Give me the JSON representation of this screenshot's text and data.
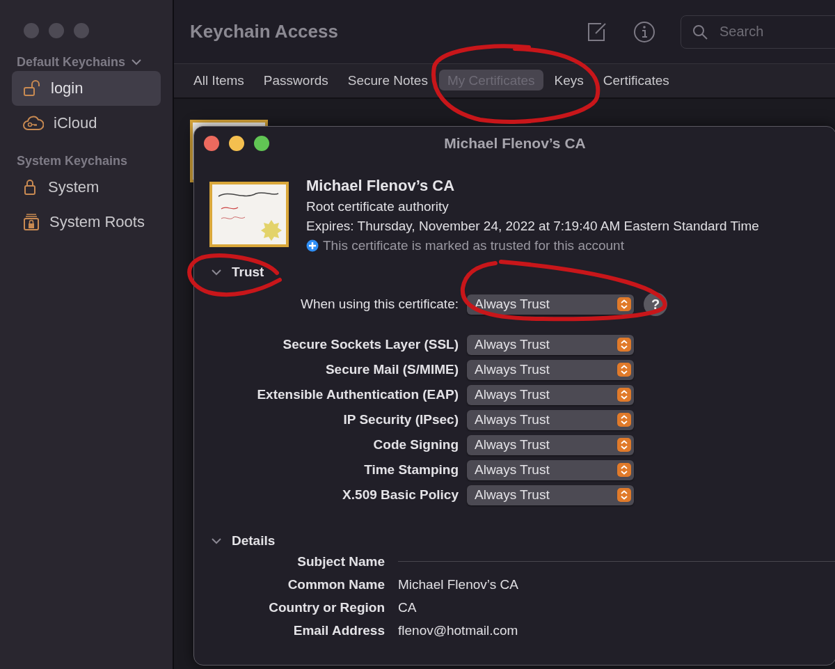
{
  "sidebar": {
    "sections": [
      {
        "title": "Default Keychains",
        "expanded": true,
        "items": [
          {
            "label": "login",
            "selected": true
          },
          {
            "label": "iCloud",
            "selected": false
          }
        ]
      },
      {
        "title": "System Keychains",
        "items": [
          {
            "label": "System",
            "selected": false
          },
          {
            "label": "System Roots",
            "selected": false
          }
        ]
      }
    ]
  },
  "window": {
    "title": "Keychain Access"
  },
  "search": {
    "placeholder": "Search"
  },
  "tabs": [
    {
      "label": "All Items",
      "selected": false
    },
    {
      "label": "Passwords",
      "selected": false
    },
    {
      "label": "Secure Notes",
      "selected": false
    },
    {
      "label": "My Certificates",
      "selected": true
    },
    {
      "label": "Keys",
      "selected": false
    },
    {
      "label": "Certificates",
      "selected": false
    }
  ],
  "dialog": {
    "title": "Michael Flenov’s CA",
    "name": "Michael Flenov’s CA",
    "subtitle": "Root certificate authority",
    "expires": "Expires: Thursday, November 24, 2022 at 7:19:40 AM Eastern Standard Time",
    "status": "This certificate is marked as trusted for this account",
    "trust": {
      "title": "Trust",
      "expanded": true,
      "main": {
        "label": "When using this certificate:",
        "value": "Always Trust"
      },
      "help": "?",
      "rows": [
        {
          "label": "Secure Sockets Layer (SSL)",
          "value": "Always Trust"
        },
        {
          "label": "Secure Mail (S/MIME)",
          "value": "Always Trust"
        },
        {
          "label": "Extensible Authentication (EAP)",
          "value": "Always Trust"
        },
        {
          "label": "IP Security (IPsec)",
          "value": "Always Trust"
        },
        {
          "label": "Code Signing",
          "value": "Always Trust"
        },
        {
          "label": "Time Stamping",
          "value": "Always Trust"
        },
        {
          "label": "X.509 Basic Policy",
          "value": "Always Trust"
        }
      ]
    },
    "details": {
      "title": "Details",
      "expanded": true,
      "rows": [
        {
          "kind": "heading",
          "label": "Subject Name"
        },
        {
          "kind": "field",
          "label": "Common Name",
          "value": "Michael Flenov’s CA"
        },
        {
          "kind": "field",
          "label": "Country or Region",
          "value": "CA"
        },
        {
          "kind": "field",
          "label": "Email Address",
          "value": "flenov@hotmail.com"
        }
      ]
    }
  },
  "markup": [
    {
      "kind": "tabs-loop"
    },
    {
      "kind": "trust-loop"
    },
    {
      "kind": "popup-loop"
    }
  ]
}
